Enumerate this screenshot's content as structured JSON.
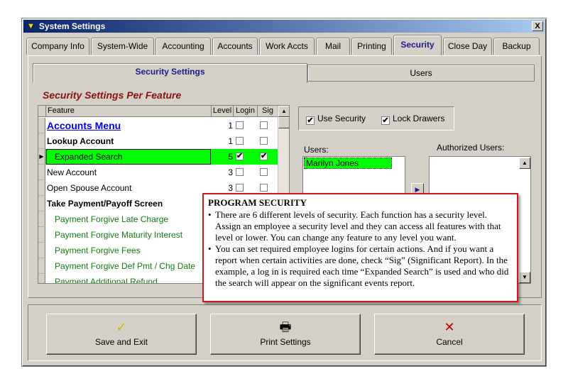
{
  "window": {
    "title": "System Settings",
    "close_label": "X"
  },
  "tabs": [
    {
      "label": "Company Info"
    },
    {
      "label": "System-Wide"
    },
    {
      "label": "Accounting"
    },
    {
      "label": "Accounts"
    },
    {
      "label": "Work Accts"
    },
    {
      "label": "Mail"
    },
    {
      "label": "Printing"
    },
    {
      "label": "Security",
      "active": true
    },
    {
      "label": "Close Day"
    },
    {
      "label": "Backup"
    }
  ],
  "subtabs": [
    {
      "label": "Security Settings",
      "active": true
    },
    {
      "label": "Users"
    }
  ],
  "section_title": "Security Settings Per Feature",
  "grid": {
    "headers": {
      "feature": "Feature",
      "level": "Level",
      "login": "Login",
      "sig": "Sig"
    },
    "rows": [
      {
        "feature": "Accounts Menu",
        "level": "1",
        "login": false,
        "sig": false,
        "style": "menu"
      },
      {
        "feature": "Lookup Account",
        "level": "1",
        "login": false,
        "sig": false,
        "style": "bold"
      },
      {
        "feature": "Expanded Search",
        "level": "5",
        "login": true,
        "sig": true,
        "style": "selected"
      },
      {
        "feature": "New Account",
        "level": "3",
        "login": false,
        "sig": false,
        "style": "normal"
      },
      {
        "feature": "Open Spouse Account",
        "level": "3",
        "login": false,
        "sig": false,
        "style": "normal"
      },
      {
        "feature": "Take Payment/Payoff Screen",
        "level": "",
        "login": null,
        "sig": null,
        "style": "bold"
      },
      {
        "feature": "Payment Forgive Late Charge",
        "level": "",
        "login": null,
        "sig": null,
        "style": "green"
      },
      {
        "feature": "Payment Forgive Maturity Interest",
        "level": "",
        "login": null,
        "sig": null,
        "style": "green"
      },
      {
        "feature": "Payment Forgive Fees",
        "level": "",
        "login": null,
        "sig": null,
        "style": "green"
      },
      {
        "feature": "Payment Forgive Def Pmt / Chg Date",
        "level": "",
        "login": null,
        "sig": null,
        "style": "green"
      },
      {
        "feature": "Payment Additional Refund",
        "level": "",
        "login": null,
        "sig": null,
        "style": "green"
      }
    ]
  },
  "options": {
    "use_security": {
      "label": "Use Security",
      "checked": true
    },
    "lock_drawers": {
      "label": "Lock Drawers",
      "checked": true
    }
  },
  "users": {
    "label": "Users:",
    "items": [
      "Marilyn Jones"
    ],
    "selected": "Marilyn Jones"
  },
  "authorized_users": {
    "label": "Authorized Users:",
    "items": []
  },
  "buttons": {
    "save": "Save and Exit",
    "print": "Print Settings",
    "cancel": "Cancel"
  },
  "tooltip": {
    "title": "PROGRAM SECURITY",
    "bullets": [
      "There are 6 different levels of security. Each function has a security level. Assign an employee a security level and they can access all features with that level or lower. You can change any feature to any level you want.",
      "You can set required employee logins for certain actions. And if you want a report when certain activities are done, check “Sig” (Significant Report). In the example, a log in is required each time “Expanded Search” is used and who did the search will appear on the significant events report."
    ]
  },
  "colors": {
    "selection_green": "#00ff00",
    "section_title": "#8b1010",
    "tooltip_border": "#d01818",
    "active_tab_text": "#1c1c8c",
    "menu_link": "#0000ee",
    "subfeature_text": "#108010"
  }
}
